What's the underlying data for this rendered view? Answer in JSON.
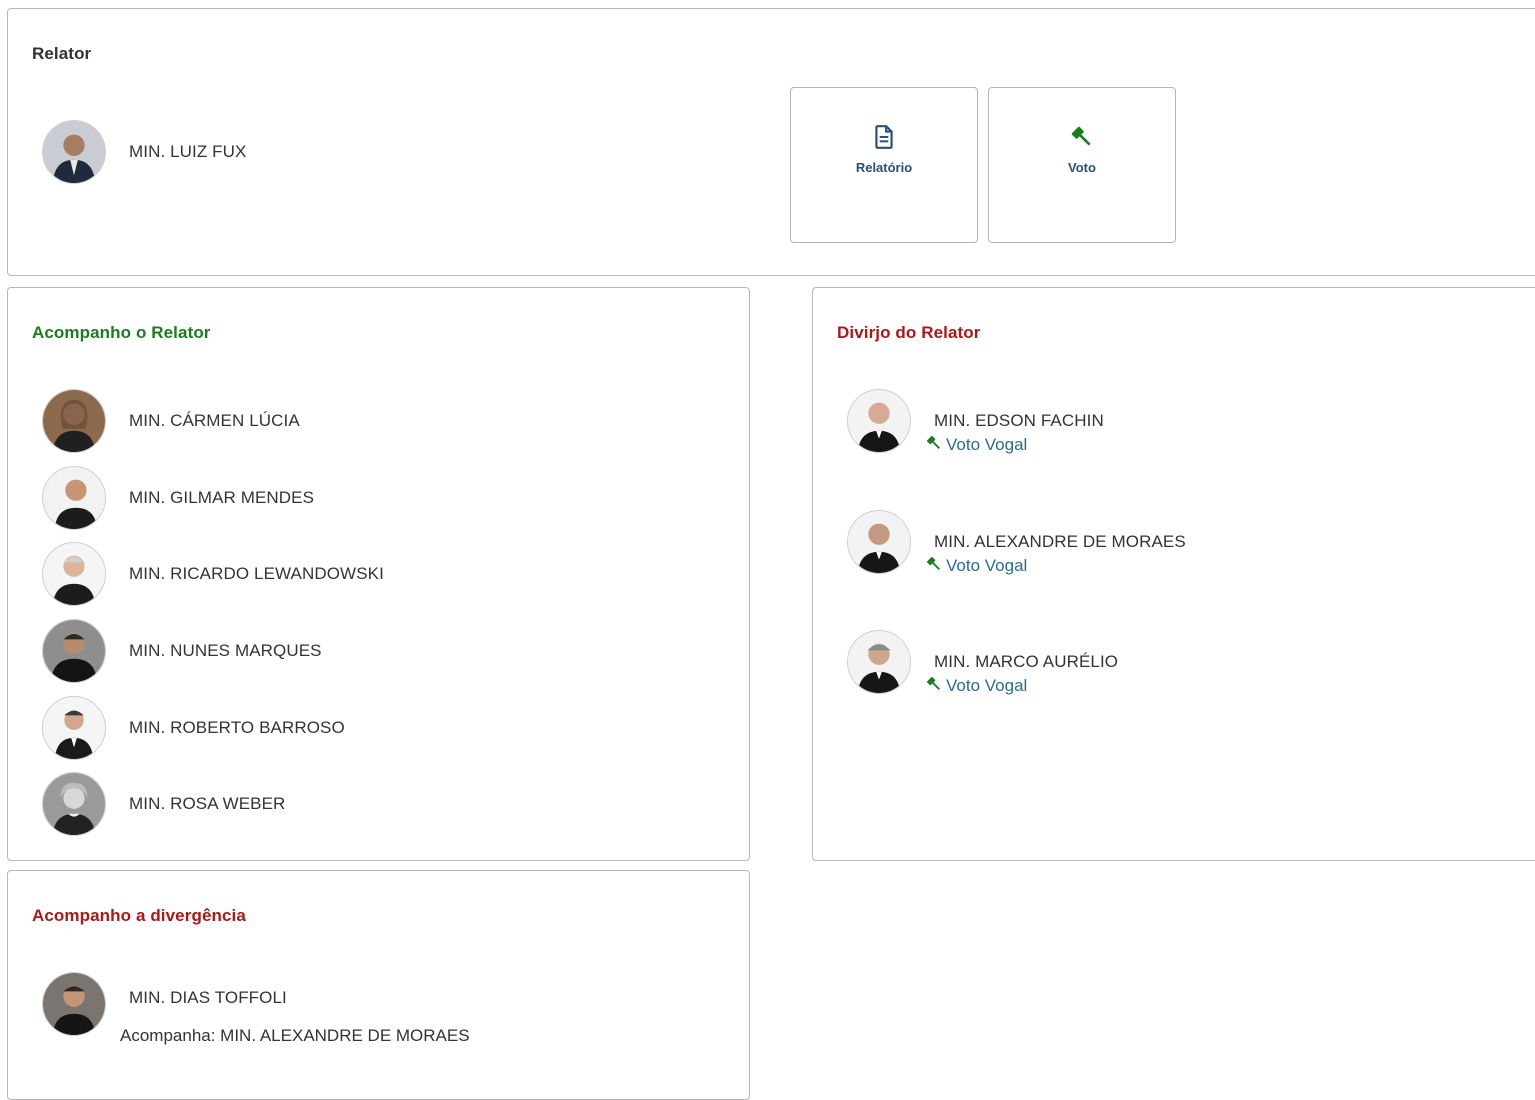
{
  "relator": {
    "title": "Relator",
    "minister": "MIN. LUIZ FUX",
    "actions": [
      {
        "label": "Relatório",
        "icon": "document-icon"
      },
      {
        "label": "Voto",
        "icon": "gavel-icon"
      }
    ]
  },
  "acompanho_relator": {
    "title": "Acompanho o Relator",
    "ministers": [
      "MIN. CÁRMEN LÚCIA",
      "MIN. GILMAR MENDES",
      "MIN. RICARDO LEWANDOWSKI",
      "MIN. NUNES MARQUES",
      "MIN. ROBERTO BARROSO",
      "MIN. ROSA WEBER"
    ]
  },
  "divirjo_relator": {
    "title": "Divirjo do Relator",
    "ministers": [
      {
        "name": "MIN. EDSON FACHIN",
        "vote_link": "Voto Vogal"
      },
      {
        "name": "MIN. ALEXANDRE DE MORAES",
        "vote_link": "Voto Vogal"
      },
      {
        "name": "MIN. MARCO AURÉLIO",
        "vote_link": "Voto Vogal"
      }
    ]
  },
  "acompanho_divergencia": {
    "title": "Acompanho a divergência",
    "ministers": [
      {
        "name": "MIN. DIAS TOFFOLI",
        "follows": "Acompanha: MIN. ALEXANDRE DE MORAES"
      }
    ]
  },
  "colors": {
    "green_title": "#1e7c1e",
    "red_title": "#a51b1b",
    "link": "#2e6a8f",
    "border": "#b8b8b8"
  }
}
